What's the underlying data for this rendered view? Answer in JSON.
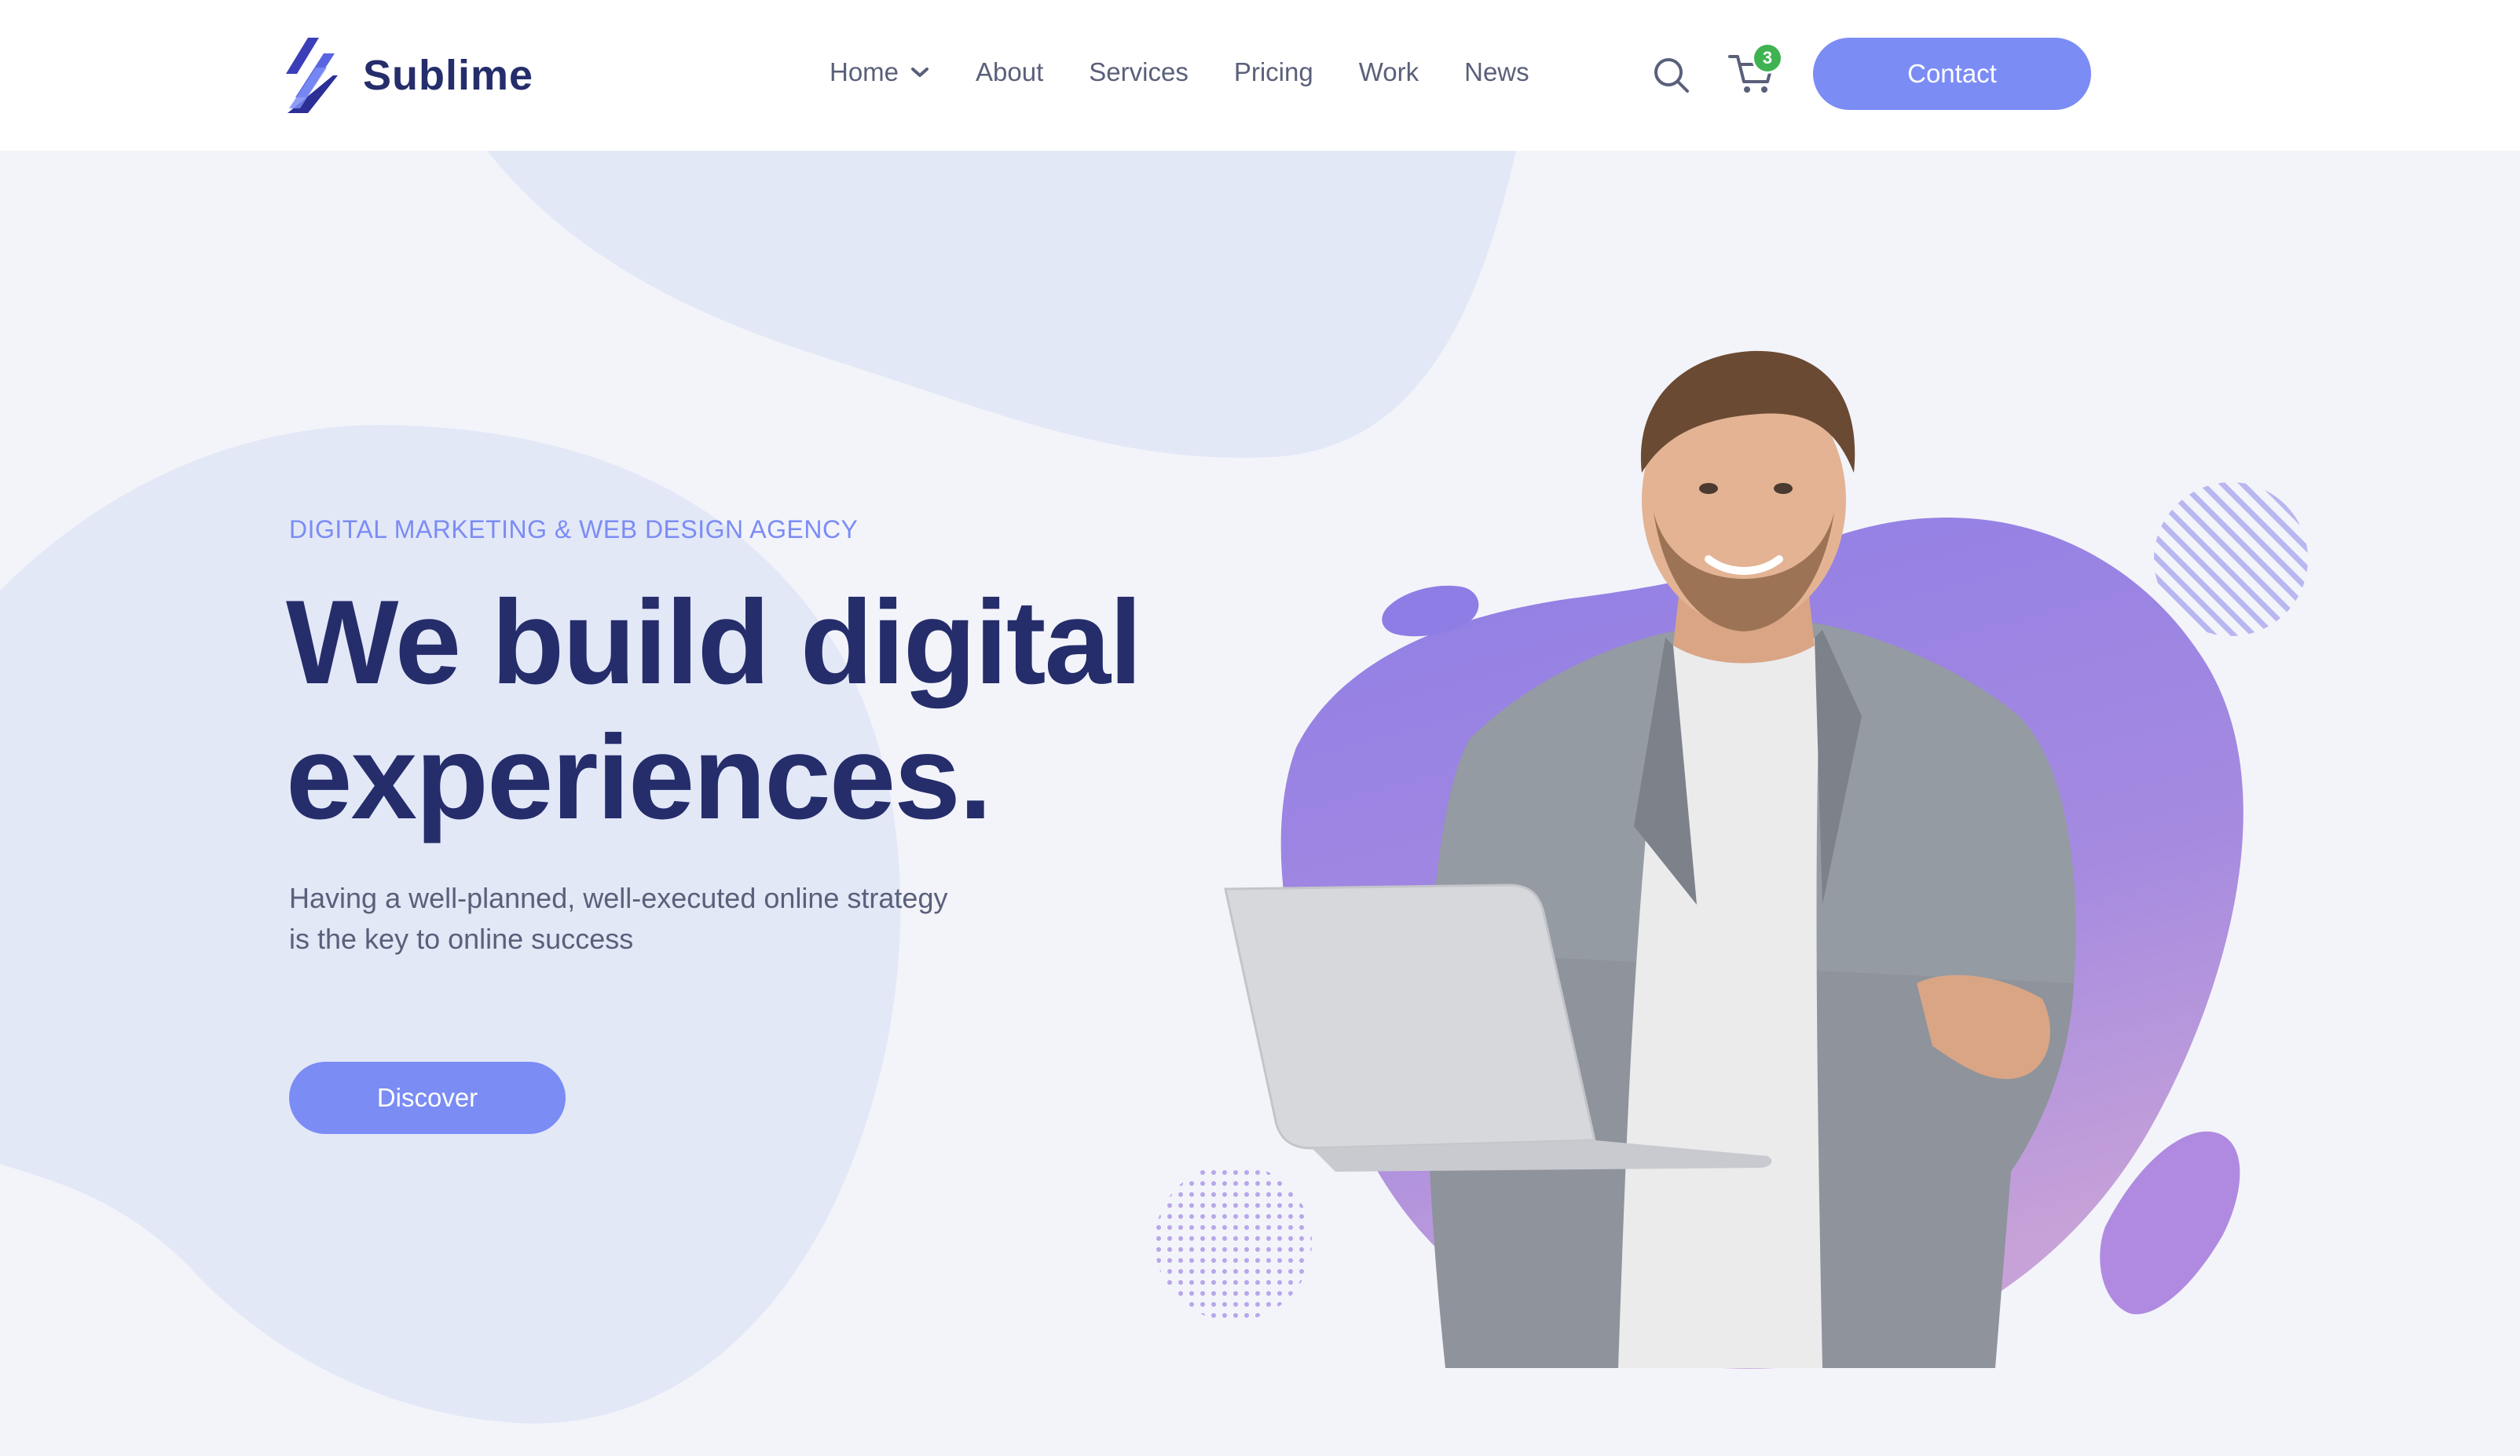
{
  "brand": {
    "name": "Sublime",
    "logo_icon": "sublime-stripes-logo",
    "color_primary": "#7b8cf5",
    "color_dark": "#252d6b",
    "color_purple": "#9b7be0"
  },
  "nav": {
    "items": [
      {
        "label": "Home",
        "has_dropdown": true,
        "dropdown_icon": "chevron-down-icon"
      },
      {
        "label": "About"
      },
      {
        "label": "Services"
      },
      {
        "label": "Pricing"
      },
      {
        "label": "Work"
      },
      {
        "label": "News"
      }
    ],
    "search_icon": "search-icon",
    "cart_icon": "shopping-cart-icon",
    "cart_count": "3",
    "contact_label": "Contact"
  },
  "hero": {
    "eyebrow": "DIGITAL MARKETING & WEB DESIGN AGENCY",
    "headline_line1": "We build digital",
    "headline_line2": "experiences.",
    "subtext_line1": "Having a well-planned, well-executed online strategy",
    "subtext_line2": "is the key to online success",
    "cta_label": "Discover",
    "image_subject": "smiling man in grey blazer holding a laptop"
  }
}
